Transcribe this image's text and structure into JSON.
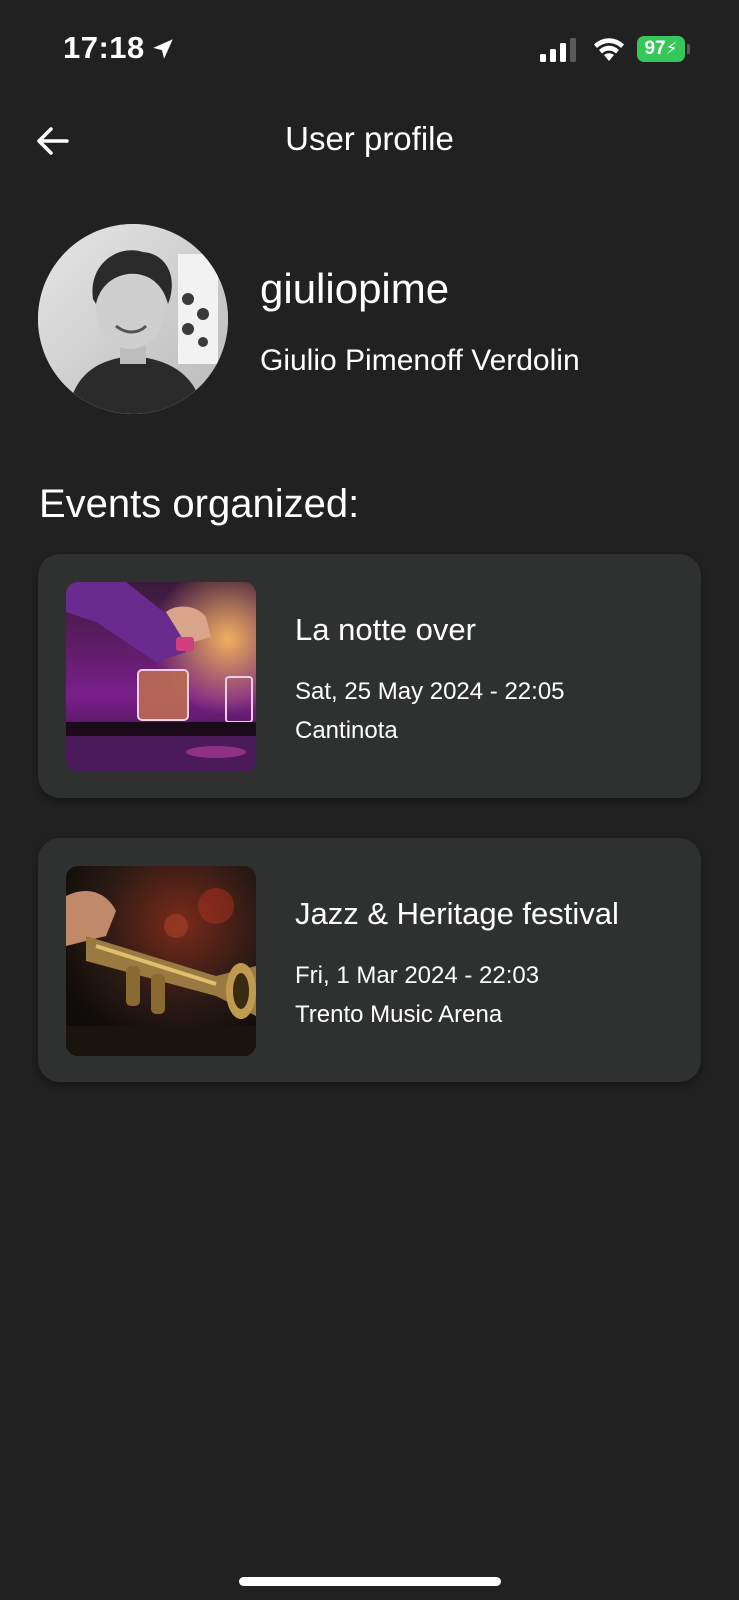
{
  "status_bar": {
    "time": "17:18",
    "battery": "97",
    "icons": [
      "location-arrow-icon",
      "cellular-signal-icon",
      "wifi-icon",
      "battery-charging-icon"
    ]
  },
  "header": {
    "title": "User profile",
    "back_icon": "arrow-left-icon"
  },
  "profile": {
    "username": "giuliopime",
    "full_name": "Giulio Pimenoff Verdolin",
    "avatar": "user-avatar-photo"
  },
  "events_section": {
    "title": "Events organized:",
    "events": [
      {
        "name": "La notte over",
        "date": "Sat, 25 May 2024 - 22:05",
        "venue": "Cantinota",
        "image": "bartender-cocktail-photo"
      },
      {
        "name": "Jazz & Heritage festival",
        "date": "Fri, 1 Mar 2024 - 22:03",
        "venue": "Trento Music Arena",
        "image": "trumpet-player-photo"
      }
    ]
  },
  "colors": {
    "background": "#212121",
    "card": "#2e312f",
    "text": "#ffffff",
    "battery": "#35c759"
  }
}
